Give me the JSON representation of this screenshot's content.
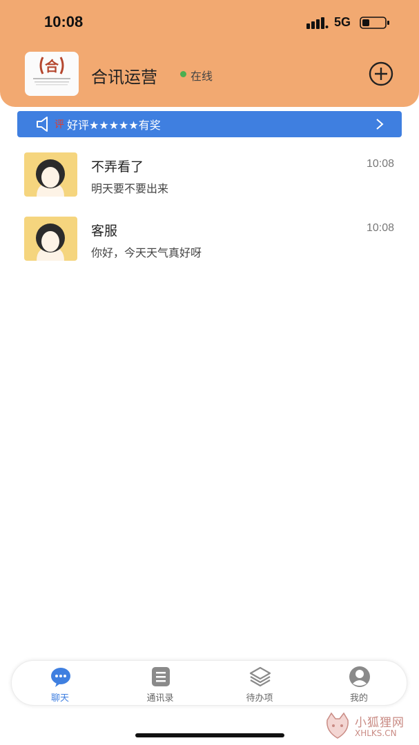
{
  "status_bar": {
    "time": "10:08",
    "network": "5G"
  },
  "header": {
    "logo_char": "合",
    "title": "合讯运营",
    "status": "在线",
    "status_color": "#4caf50"
  },
  "banner": {
    "mark": "评",
    "text": "好评★★★★★有奖"
  },
  "chats": [
    {
      "name": "不弄看了",
      "message": "明天要不要出来",
      "time": "10:08"
    },
    {
      "name": "客服",
      "message": "你好，今天天气真好呀",
      "time": "10:08"
    }
  ],
  "tabs": [
    {
      "label": "聊天",
      "icon": "chat-icon",
      "active": true
    },
    {
      "label": "通讯录",
      "icon": "contacts-icon",
      "active": false
    },
    {
      "label": "待办项",
      "icon": "layers-icon",
      "active": false
    },
    {
      "label": "我的",
      "icon": "profile-icon",
      "active": false
    }
  ],
  "watermark": {
    "cn": "小狐狸网",
    "en": "XHLKS.CN"
  },
  "colors": {
    "header": "#f2a971",
    "accent": "#3f7fe0",
    "avatar_bg": "#f5d57e"
  }
}
